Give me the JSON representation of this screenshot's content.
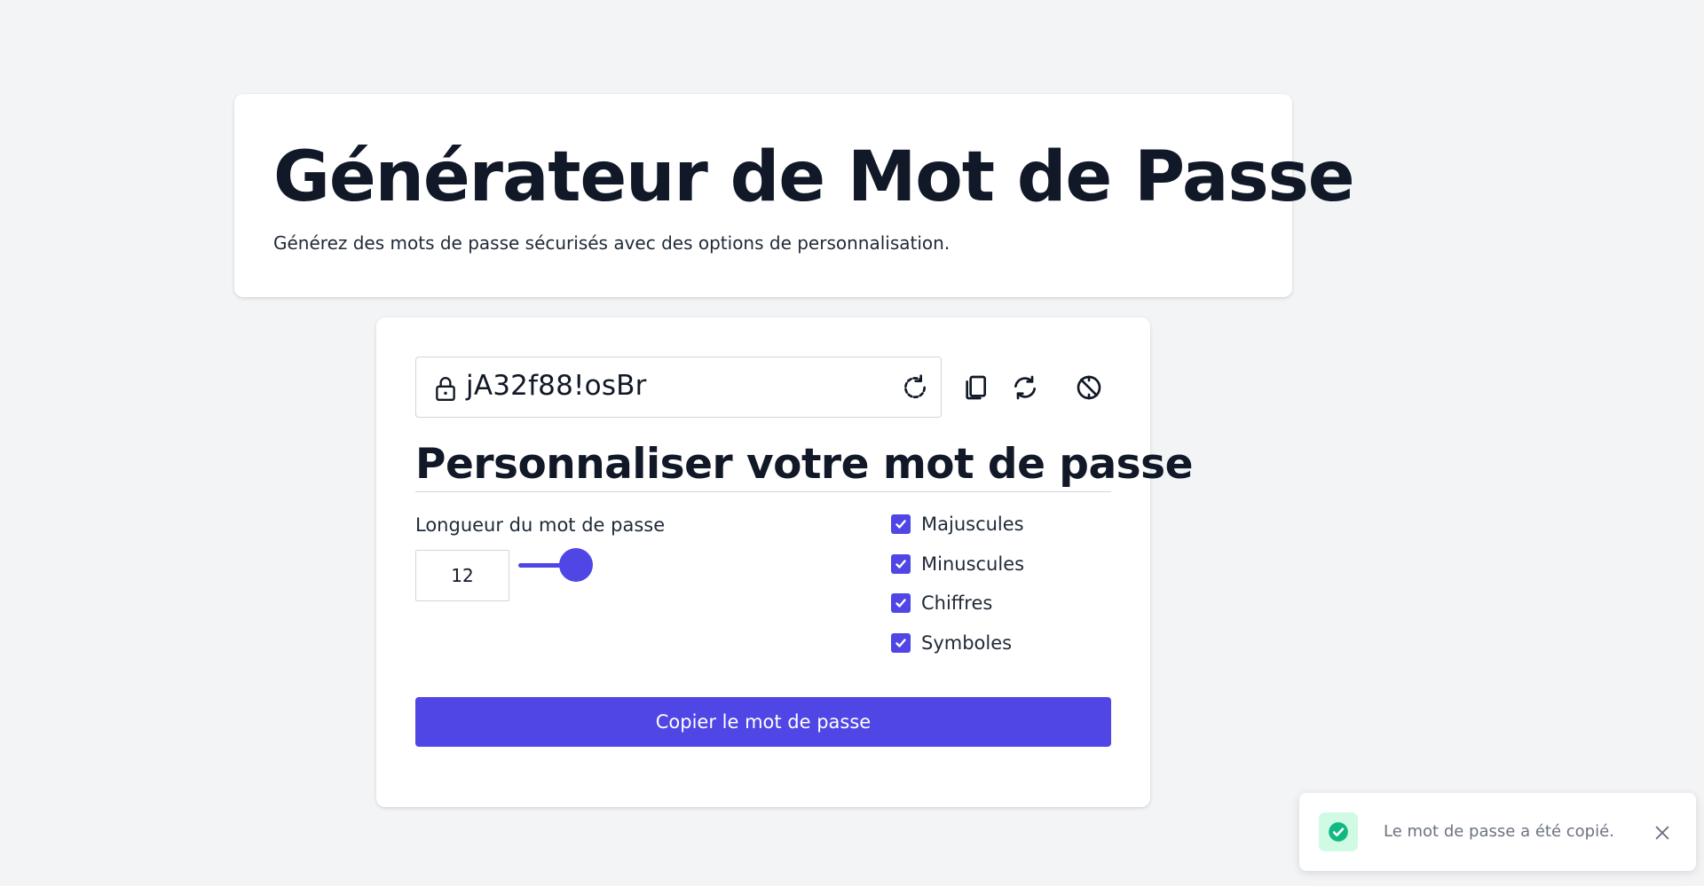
{
  "header": {
    "title": "Générateur de Mot de Passe",
    "subtitle": "Générez des mots de passe sécurisés avec des options de personnalisation."
  },
  "password": {
    "value": "jA32f88!osBr",
    "icons": [
      "lock-icon",
      "refresh-icon",
      "copy-icon",
      "sync-icon",
      "hide-icon"
    ]
  },
  "customize": {
    "title": "Personnaliser votre mot de passe",
    "length_label": "Longueur du mot de passe",
    "length_value": "12",
    "slider_fill_fraction": 0.15,
    "options": [
      {
        "label": "Majuscules",
        "checked": true
      },
      {
        "label": "Minuscules",
        "checked": true
      },
      {
        "label": "Chiffres",
        "checked": true
      },
      {
        "label": "Symboles",
        "checked": true
      }
    ]
  },
  "actions": {
    "copy_label": "Copier le mot de passe"
  },
  "toast": {
    "message": "Le mot de passe a été copié.",
    "icon": "check-circle-icon"
  },
  "colors": {
    "accent": "#4f46e5",
    "success": "#10b981",
    "background": "#f3f4f6"
  }
}
